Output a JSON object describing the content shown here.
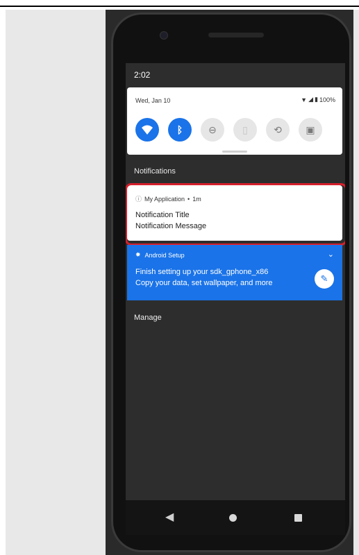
{
  "status_bar": {
    "time": "2:02"
  },
  "quick_settings": {
    "date": "Wed, Jan 10",
    "battery": "100%",
    "tiles": [
      {
        "name": "wifi",
        "active": true
      },
      {
        "name": "bluetooth",
        "active": true
      },
      {
        "name": "do-not-disturb",
        "active": false
      },
      {
        "name": "flashlight",
        "active": false
      },
      {
        "name": "auto-rotate",
        "active": false
      },
      {
        "name": "battery-saver",
        "active": false
      }
    ]
  },
  "notifications": {
    "section_label": "Notifications",
    "items": [
      {
        "app": "My Application",
        "time": "1m",
        "title": "Notification Title",
        "message": "Notification Message",
        "highlight_color": "#d6202c"
      },
      {
        "app": "Android Setup",
        "title": "Finish setting up your sdk_gphone_x86",
        "message": "Copy your data, set wallpaper, and more",
        "background": "#1a73e8"
      }
    ],
    "manage_label": "Manage"
  },
  "colors": {
    "accent": "#1a73e8",
    "highlight": "#d6202c",
    "shade": "#2d2d2d"
  }
}
